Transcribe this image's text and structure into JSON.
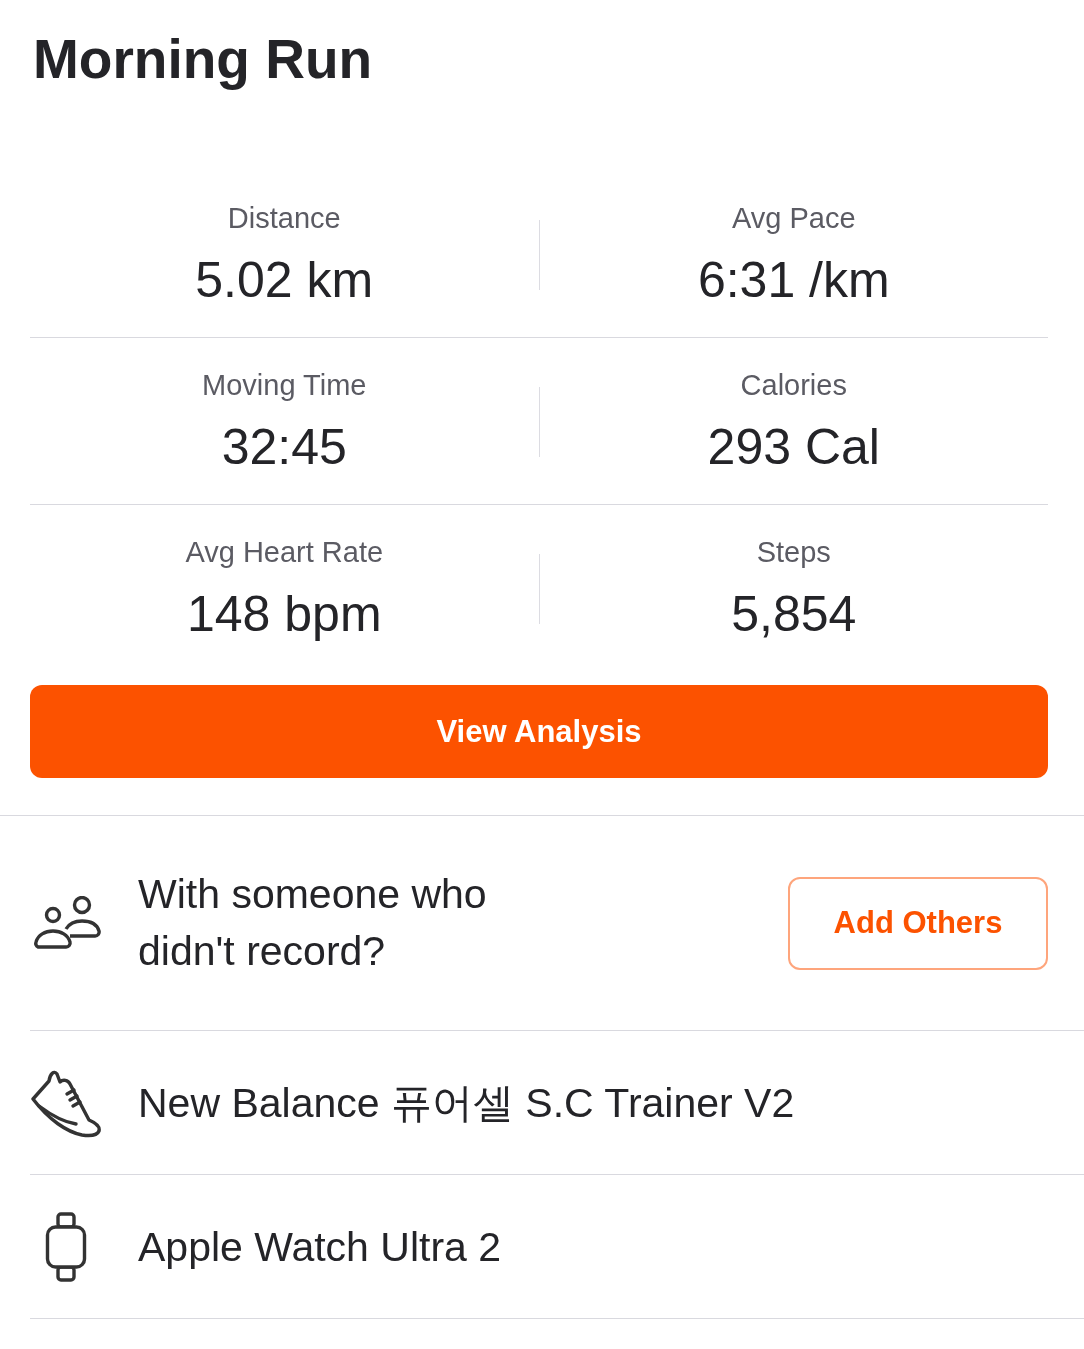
{
  "activity": {
    "title": "Morning Run"
  },
  "stats": [
    {
      "label": "Distance",
      "value": "5.02 km"
    },
    {
      "label": "Avg Pace",
      "value": "6:31 /km"
    },
    {
      "label": "Moving Time",
      "value": "32:45"
    },
    {
      "label": "Calories",
      "value": "293 Cal"
    },
    {
      "label": "Avg Heart Rate",
      "value": "148 bpm"
    },
    {
      "label": "Steps",
      "value": "5,854"
    }
  ],
  "primary_button": {
    "label": "View Analysis"
  },
  "companions": {
    "prompt": "With someone who didn't record?",
    "button": "Add Others"
  },
  "gear": [
    {
      "kind": "shoes",
      "name": "New Balance 퓨어셀 S.C Trainer V2"
    },
    {
      "kind": "watch",
      "name": "Apple Watch Ultra 2"
    }
  ]
}
